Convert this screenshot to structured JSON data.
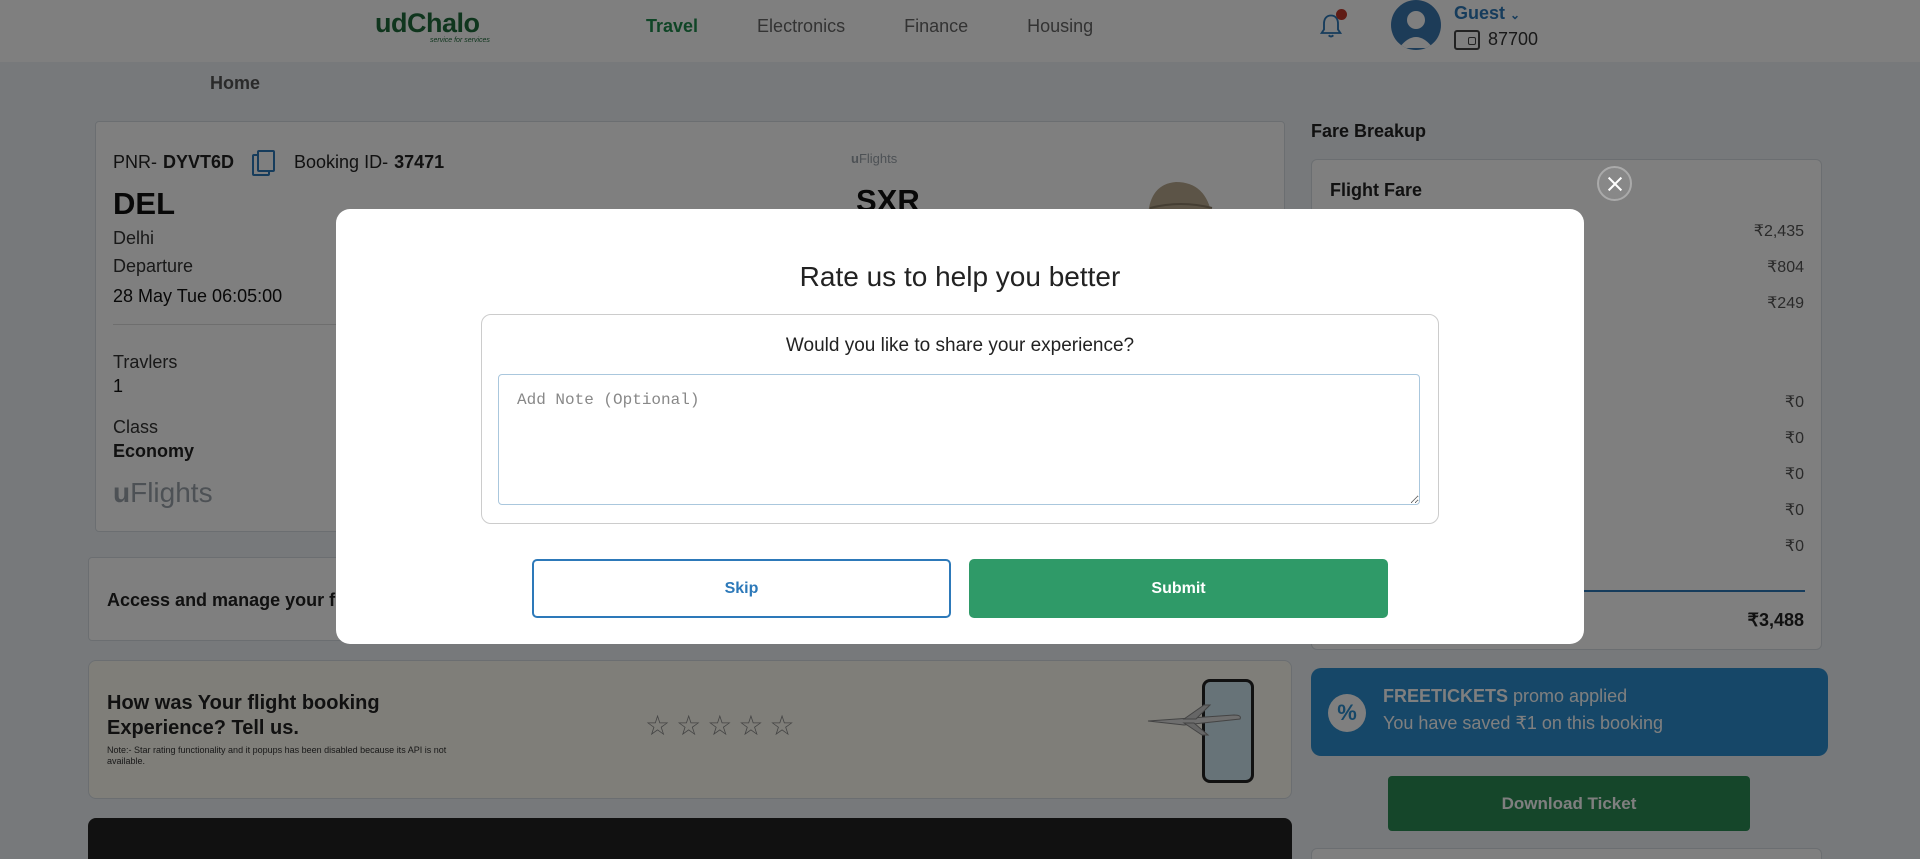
{
  "header": {
    "logo": "udChalo",
    "logo_tagline": "service for services",
    "nav": [
      {
        "label": "Travel",
        "active": true
      },
      {
        "label": "Electronics",
        "active": false
      },
      {
        "label": "Finance",
        "active": false
      },
      {
        "label": "Housing",
        "active": false
      }
    ],
    "user_name": "Guest",
    "wallet_balance": "87700",
    "icons": {
      "notification": "bell-icon",
      "wallet": "wallet-icon",
      "dropdown": "chevron-down-icon"
    }
  },
  "breadcrumb": "Home",
  "booking": {
    "pnr_label": "PNR-",
    "pnr": "DYVT6D",
    "booking_id_label": "Booking ID-",
    "booking_id": "37471",
    "from_code": "DEL",
    "from_city": "Delhi",
    "departure_label": "Departure",
    "departure_value": "28 May Tue 06:05:00",
    "to_code": "SXR",
    "travellers_label": "Travlers",
    "travellers_value": "1",
    "class_label": "Class",
    "class_value": "Economy",
    "brand": "Flights",
    "brand_prefix": "u"
  },
  "access_text": "Access and manage your fli",
  "rating_card": {
    "title": "How was Your flight booking Experience? Tell us.",
    "note": "Note:- Star rating functionality and it popups has been disabled because its API is not available.",
    "stars": [
      "☆",
      "☆",
      "☆",
      "☆",
      "☆"
    ]
  },
  "fare": {
    "heading": "Fare Breakup",
    "title": "Flight Fare",
    "values": [
      "₹2,435",
      "₹804",
      "₹249",
      "₹0",
      "₹0",
      "₹0",
      "₹0",
      "₹0"
    ],
    "total": "₹3,488"
  },
  "promo": {
    "code": "FREETICKETS",
    "applied_text": "promo applied",
    "saved_text": "You have saved ₹1 on this booking",
    "icon": "%"
  },
  "download_label": "Download Ticket",
  "modal": {
    "title": "Rate us to help you better",
    "question": "Would you like to share your experience?",
    "note_placeholder": "Add Note (Optional)",
    "skip_label": "Skip",
    "submit_label": "Submit"
  },
  "colors": {
    "brand_green": "#1e6b3a",
    "nav_active": "#1f8a4c",
    "accent_blue": "#2d79b9",
    "submit_green": "#2f9a68",
    "promo_blue": "#2d8fd0"
  }
}
